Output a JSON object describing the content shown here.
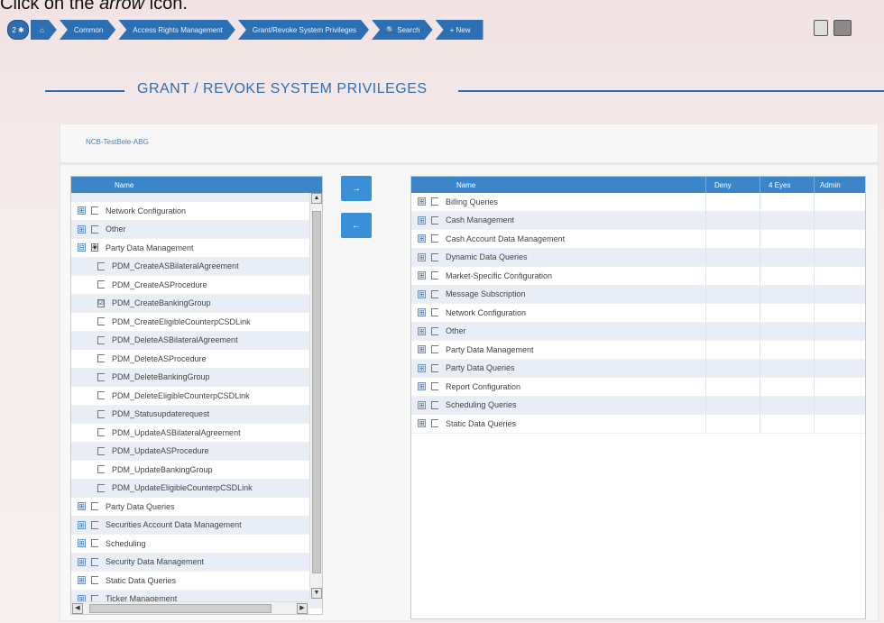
{
  "instruction": {
    "prefix": "Click on the ",
    "emph": "arrow",
    "suffix": " icon."
  },
  "breadcrumb": {
    "badge": "2 ✱",
    "home_icon": "⌂",
    "items": [
      "Common",
      "Access Rights Management",
      "Grant/Revoke System Privileges",
      "🔍 Search",
      "+ New"
    ]
  },
  "page_title": "GRANT / REVOKE SYSTEM PRIVILEGES",
  "party_label": "NCB-TestBele-ABG",
  "left_tree": {
    "header": "Name",
    "rows": [
      {
        "label": "",
        "type": "partial"
      },
      {
        "label": "Network Configuration",
        "type": "parent",
        "expander": "⊞",
        "check": ""
      },
      {
        "label": "Other",
        "type": "parent",
        "expander": "⊞",
        "check": ""
      },
      {
        "label": "Party Data Management",
        "type": "parent",
        "expander": "⊟",
        "check": "◉"
      },
      {
        "label": "PDM_CreateASBilateralAgreement",
        "type": "child",
        "check": ""
      },
      {
        "label": "PDM_CreateASProcedure",
        "type": "child",
        "check": ""
      },
      {
        "label": "PDM_CreateBankingGroup",
        "type": "child",
        "check": "☑"
      },
      {
        "label": "PDM_CreateEligibleCounterpCSDLink",
        "type": "child",
        "check": ""
      },
      {
        "label": "PDM_DeleteASBilateralAgreement",
        "type": "child",
        "check": ""
      },
      {
        "label": "PDM_DeleteASProcedure",
        "type": "child",
        "check": ""
      },
      {
        "label": "PDM_DeleteBankingGroup",
        "type": "child",
        "check": ""
      },
      {
        "label": "PDM_DeleteEligibleCounterpCSDLink",
        "type": "child",
        "check": ""
      },
      {
        "label": "PDM_Statusupdaterequest",
        "type": "child",
        "check": ""
      },
      {
        "label": "PDM_UpdateASBilateralAgreement",
        "type": "child",
        "check": ""
      },
      {
        "label": "PDM_UpdateASProcedure",
        "type": "child",
        "check": ""
      },
      {
        "label": "PDM_UpdateBankingGroup",
        "type": "child",
        "check": ""
      },
      {
        "label": "PDM_UpdateEligibleCounterpCSDLink",
        "type": "child",
        "check": ""
      },
      {
        "label": "Party Data Queries",
        "type": "parent",
        "expander": "⊞",
        "check": ""
      },
      {
        "label": "Securities Account Data Management",
        "type": "parent",
        "expander": "⊞",
        "check": ""
      },
      {
        "label": "Scheduling",
        "type": "parent",
        "expander": "⊞",
        "check": ""
      },
      {
        "label": "Security Data Management",
        "type": "parent",
        "expander": "⊞",
        "check": ""
      },
      {
        "label": "Static Data Queries",
        "type": "parent",
        "expander": "⊞",
        "check": ""
      },
      {
        "label": "Ticker Management",
        "type": "parent",
        "expander": "⊞",
        "check": ""
      }
    ]
  },
  "transfer": {
    "add_label": "→",
    "remove_label": "←"
  },
  "right_grid": {
    "headers": {
      "name": "Name",
      "deny": "Deny",
      "four_eyes": "4 Eyes",
      "admin": "Admin"
    },
    "rows": [
      "Billing Queries",
      "Cash Management",
      "Cash Account Data Management",
      "Dynamic Data Queries",
      "Market-Specific Configuration",
      "Message Subscription",
      "Network Configuration",
      "Other",
      "Party Data Management",
      "Party Data Queries",
      "Report Configuration",
      "Scheduling Queries",
      "Static Data Queries"
    ]
  },
  "colors": {
    "accent": "#2f6eb0",
    "header": "#3a86c9",
    "button": "#3a90d6",
    "alt_row": "#e9eef6"
  }
}
